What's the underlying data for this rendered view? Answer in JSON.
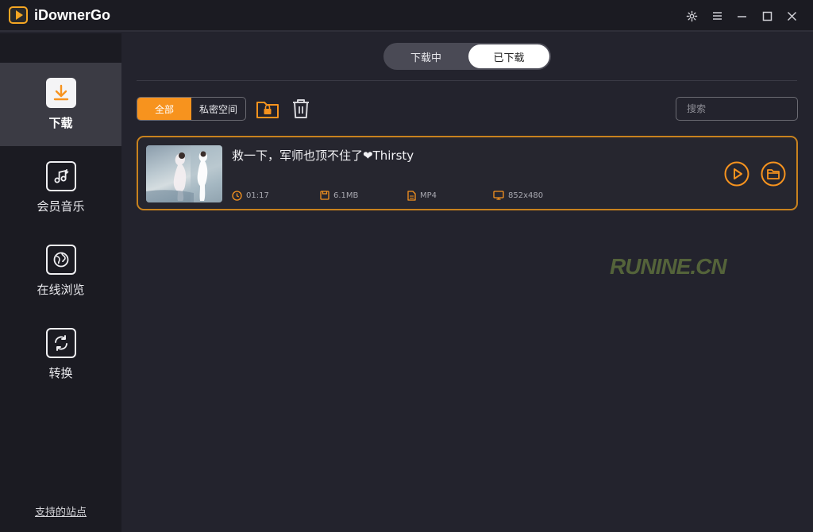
{
  "app": {
    "title": "iDownerGo"
  },
  "sidebar": {
    "items": [
      {
        "label": "下载",
        "icon": "download-icon",
        "active": true
      },
      {
        "label": "会员音乐",
        "icon": "music-icon",
        "active": false
      },
      {
        "label": "在线浏览",
        "icon": "globe-icon",
        "active": false
      },
      {
        "label": "转换",
        "icon": "convert-icon",
        "active": false
      }
    ],
    "support_link": "支持的站点"
  },
  "tabs": {
    "downloading": "下载中",
    "downloaded": "已下载"
  },
  "filter": {
    "all": "全部",
    "private": "私密空间"
  },
  "search": {
    "placeholder": "搜索"
  },
  "downloads": [
    {
      "title": "救一下，军师也顶不住了❤Thirsty",
      "duration": "01:17",
      "size": "6.1MB",
      "format": "MP4",
      "resolution": "852x480"
    }
  ],
  "watermark": "RUNINE.CN",
  "colors": {
    "accent": "#f7931e",
    "card_border": "#c8821e",
    "sidebar": "#1b1b22",
    "main_bg": "#23232d"
  }
}
